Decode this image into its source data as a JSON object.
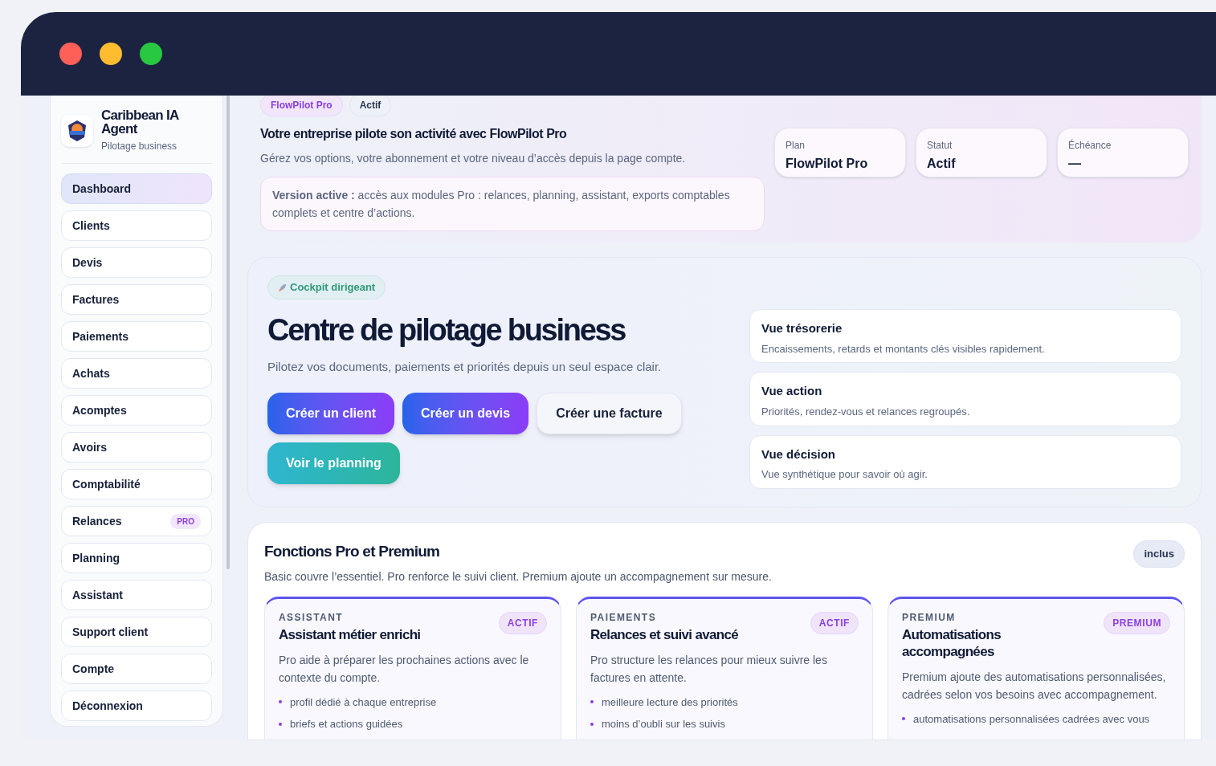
{
  "sidebar": {
    "brand": {
      "name": "Caribbean IA Agent",
      "tagline": "Pilotage business"
    },
    "items": [
      {
        "label": "Dashboard",
        "selected": true
      },
      {
        "label": "Clients",
        "selected": false
      },
      {
        "label": "Devis",
        "selected": false
      },
      {
        "label": "Factures",
        "selected": false
      },
      {
        "label": "Paiements",
        "selected": false
      },
      {
        "label": "Achats",
        "selected": false
      },
      {
        "label": "Acomptes",
        "selected": false
      },
      {
        "label": "Avoirs",
        "selected": false
      },
      {
        "label": "Comptabilité",
        "selected": false
      },
      {
        "label": "Relances",
        "selected": false,
        "badge": "PRO"
      },
      {
        "label": "Planning",
        "selected": false
      },
      {
        "label": "Assistant",
        "selected": false
      },
      {
        "label": "Support client",
        "selected": false
      },
      {
        "label": "Compte",
        "selected": false
      },
      {
        "label": "Déconnexion",
        "selected": false
      }
    ]
  },
  "account": {
    "pills": [
      "FlowPilot Pro",
      "Actif"
    ],
    "title": "Votre entreprise pilote son activité avec FlowPilot Pro",
    "subtitle": "Gérez vos options, votre abonnement et votre niveau d’accès depuis la page compte.",
    "notice": "**Version active :** accès aux modules Pro : relances, planning, assistant, exports comptables complets et centre d’actions.",
    "stats": [
      {
        "label": "Plan",
        "value": "FlowPilot Pro"
      },
      {
        "label": "Statut",
        "value": "Actif"
      },
      {
        "label": "Échéance",
        "value": "—"
      }
    ]
  },
  "hero": {
    "tag": "Cockpit dirigeant",
    "title": "Centre de pilotage business",
    "subtitle": "Pilotez vos documents, paiements et priorités depuis un seul espace clair.",
    "buttons": [
      {
        "label": "Créer un client",
        "kind": "primary"
      },
      {
        "label": "Créer un devis",
        "kind": "primary"
      },
      {
        "label": "Créer une facture",
        "kind": "secondary"
      },
      {
        "label": "Voir le planning",
        "kind": "teal"
      }
    ],
    "views": [
      {
        "title": "Vue trésorerie",
        "text": "Encaissements, retards et montants clés visibles rapidement."
      },
      {
        "title": "Vue action",
        "text": "Priorités, rendez-vous et relances regroupés."
      },
      {
        "title": "Vue décision",
        "text": "Vue synthétique pour savoir où agir."
      }
    ]
  },
  "features": {
    "title": "Fonctions Pro et Premium",
    "subtitle": "Basic couvre l’essentiel. Pro renforce le suivi client. Premium ajoute un accompagnement sur mesure.",
    "badge": "inclus",
    "cards": [
      {
        "category": "ASSISTANT",
        "title": "Assistant métier enrichi",
        "badge": "ACTIF",
        "text": "Pro aide à préparer les prochaines actions avec le contexte du compte.",
        "bullets": [
          "profil dédié à chaque entreprise",
          "briefs et actions guidées"
        ]
      },
      {
        "category": "PAIEMENTS",
        "title": "Relances et suivi avancé",
        "badge": "ACTIF",
        "text": "Pro structure les relances pour mieux suivre les factures en attente.",
        "bullets": [
          "meilleure lecture des priorités",
          "moins d’oubli sur les suivis"
        ]
      },
      {
        "category": "PREMIUM",
        "title": "Automatisations accompagnées",
        "badge": "PREMIUM",
        "text": "Premium ajoute des automatisations personnalisées, cadrées selon vos besoins avec accompagnement.",
        "bullets": [
          "automatisations personnalisées cadrées avec vous"
        ]
      }
    ]
  }
}
